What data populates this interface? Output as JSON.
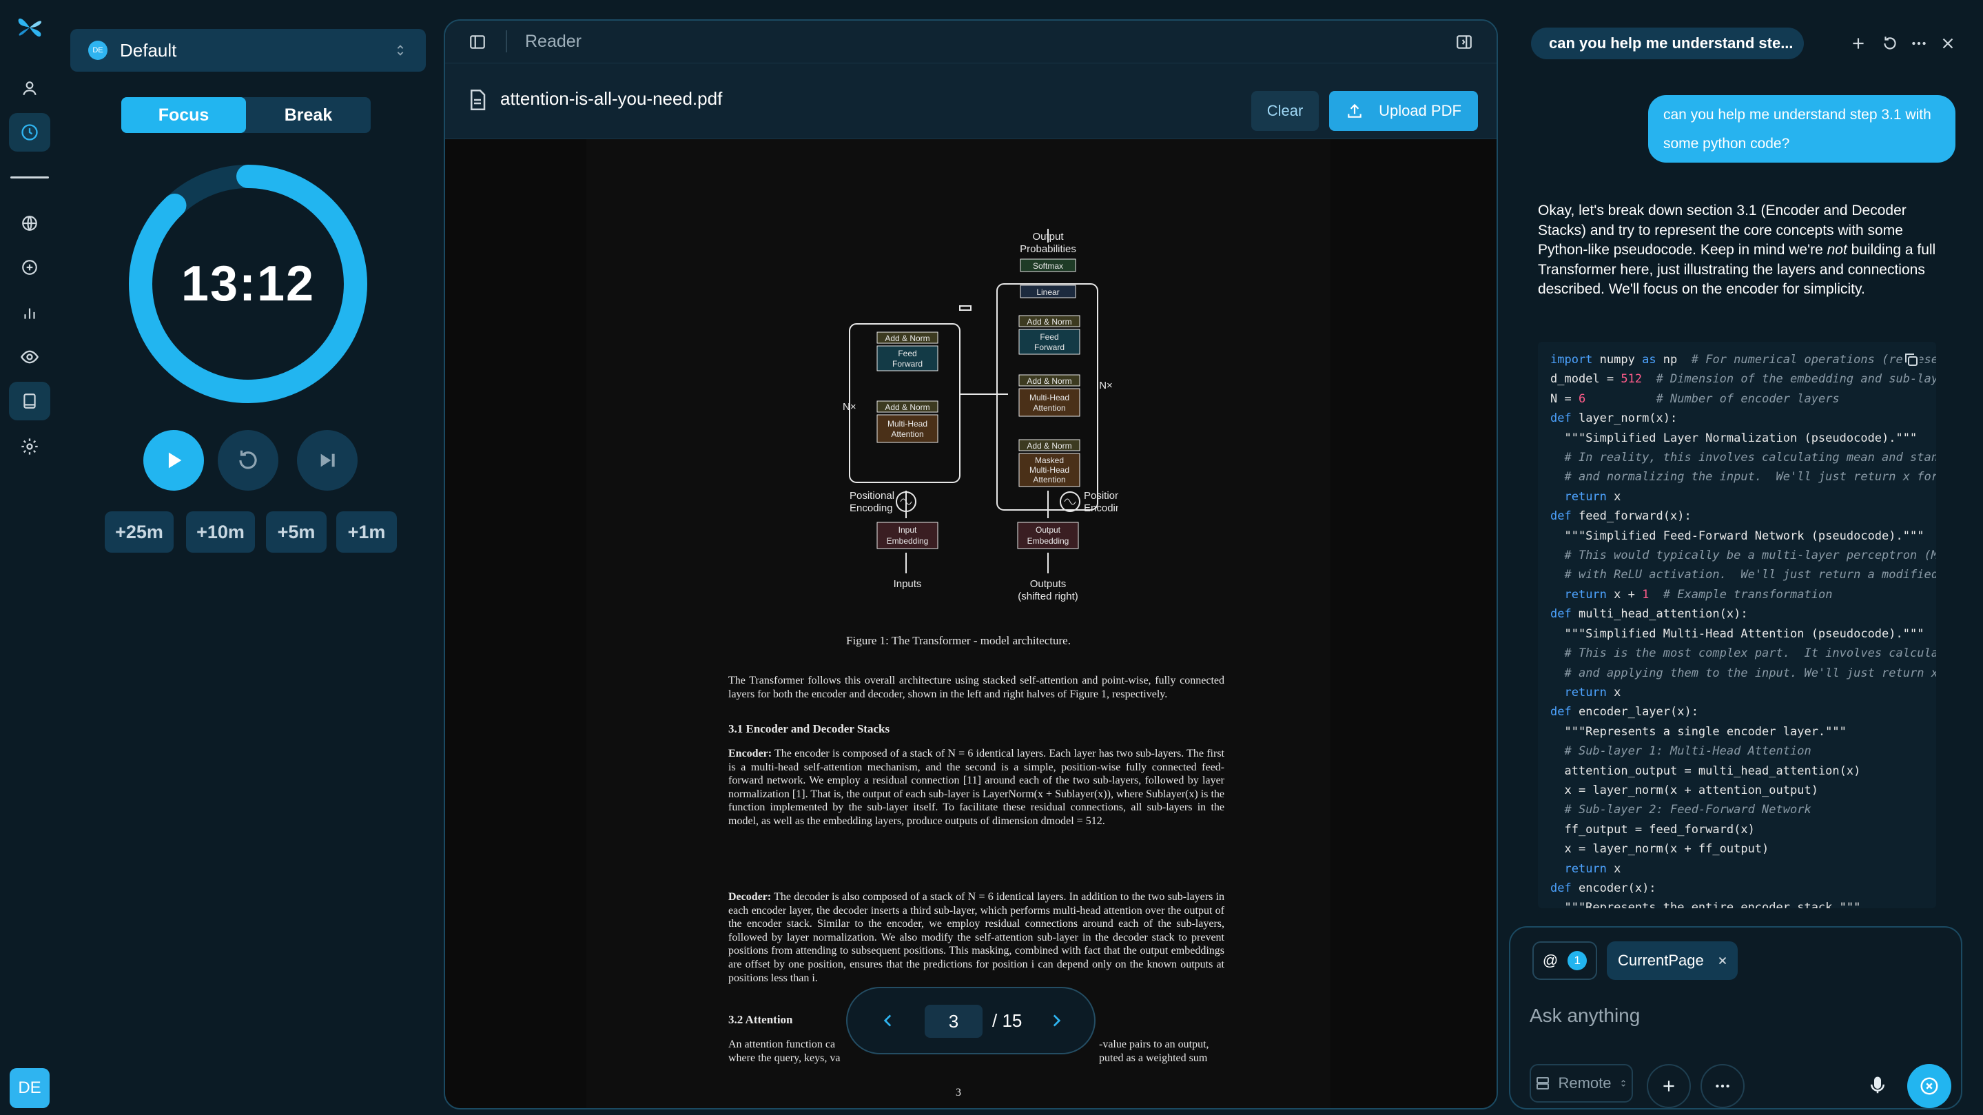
{
  "profile": {
    "badge": "DE",
    "name": "Default"
  },
  "timer": {
    "modes": [
      "Focus",
      "Break"
    ],
    "active_mode": "Focus",
    "time": "13:12",
    "progress": 0.88,
    "add_buttons": [
      "+25m",
      "+10m",
      "+5m",
      "+1m"
    ]
  },
  "user": {
    "avatar": "DE"
  },
  "reader": {
    "title": "Reader",
    "file_name": "attention-is-all-you-need.pdf",
    "clear_label": "Clear",
    "upload_label": "Upload PDF",
    "page": {
      "current": "3",
      "total": "/ 15",
      "footer_number": "3"
    },
    "figure": {
      "caption": "Figure 1: The Transformer - model architecture.",
      "labels": {
        "output_probs_1": "Output",
        "output_probs_2": "Probabilities",
        "softmax": "Softmax",
        "linear": "Linear",
        "add_norm": "Add & Norm",
        "feed": "Feed",
        "forward": "Forward",
        "multi_head": "Multi-Head",
        "attention": "Attention",
        "masked": "Masked",
        "nx": "N×",
        "positional": "Positional",
        "encoding": "Encoding",
        "input": "Input",
        "embedding": "Embedding",
        "output": "Output",
        "inputs": "Inputs",
        "outputs": "Outputs",
        "shifted": "(shifted right)"
      }
    },
    "body": {
      "intro": "The Transformer follows this overall architecture using stacked self-attention and point-wise, fully connected layers for both the encoder and decoder, shown in the left and right halves of Figure 1, respectively.",
      "s31_head": "3.1    Encoder and Decoder Stacks",
      "encoder_label": "Encoder:",
      "encoder_text": "The encoder is composed of a stack of N = 6 identical layers. Each layer has two sub-layers. The first is a multi-head self-attention mechanism, and the second is a simple, position-wise fully connected feed-forward network. We employ a residual connection [11] around each of the two sub-layers, followed by layer normalization [1]. That is, the output of each sub-layer is LayerNorm(x + Sublayer(x)), where Sublayer(x) is the function implemented by the sub-layer itself. To facilitate these residual connections, all sub-layers in the model, as well as the embedding layers, produce outputs of dimension dmodel = 512.",
      "decoder_label": "Decoder:",
      "decoder_text": "The decoder is also composed of a stack of N = 6 identical layers. In addition to the two sub-layers in each encoder layer, the decoder inserts a third sub-layer, which performs multi-head attention over the output of the encoder stack. Similar to the encoder, we employ residual connections around each of the sub-layers, followed by layer normalization. We also modify the self-attention sub-layer in the decoder stack to prevent positions from attending to subsequent positions. This masking, combined with fact that the output embeddings are offset by one position, ensures that the predictions for position i can depend only on the known outputs at positions less than i.",
      "s32_head": "3.2    Attention",
      "attn_left": "An attention function ca",
      "attn_left2": "where the query, keys, va",
      "attn_right": "-value pairs to an output,",
      "attn_right2": "puted as a weighted sum"
    }
  },
  "chat": {
    "tab_title": "can you help me understand ste...",
    "user_message": "can you help me understand step 3.1 with some python code?",
    "answer_pre": "Okay, let's break down section 3.1 (Encoder and Decoder Stacks) and try to represent the core concepts with some Python-like pseudocode. Keep in mind we're ",
    "answer_em": "not",
    "answer_post": " building a full Transformer here, just illustrating the layers and connections described.  We'll focus on the encoder for simplicity.",
    "code_lines": [
      "import numpy as np  # For numerical operations (represe",
      "d_model = 512  # Dimension of the embedding and sub-laye",
      "N = 6          # Number of encoder layers",
      "def layer_norm(x):",
      "  \"\"\"Simplified Layer Normalization (pseudocode).\"\"\"",
      "  # In reality, this involves calculating mean and stanc",
      "  # and normalizing the input.  We'll just return x for",
      "  return x",
      "def feed_forward(x):",
      "  \"\"\"Simplified Feed-Forward Network (pseudocode).\"\"\"",
      "  # This would typically be a multi-layer perceptron (ML",
      "  # with ReLU activation.  We'll just return a modified",
      "  return x + 1  # Example transformation",
      "def multi_head_attention(x):",
      "  \"\"\"Simplified Multi-Head Attention (pseudocode).\"\"\"",
      "  # This is the most complex part.  It involves calcula",
      "  # and applying them to the input. We'll just return x",
      "  return x",
      "def encoder_layer(x):",
      "  \"\"\"Represents a single encoder layer.\"\"\"",
      "  # Sub-layer 1: Multi-Head Attention",
      "  attention_output = multi_head_attention(x)",
      "  x = layer_norm(x + attention_output)",
      "  # Sub-layer 2: Feed-Forward Network",
      "  ff_output = feed_forward(x)",
      "  x = layer_norm(x + ff_output)",
      "  return x",
      "def encoder(x):",
      "  \"\"\"Represents the entire encoder stack.\"\"\""
    ],
    "composer": {
      "at": "@",
      "context_count": "1",
      "context_chip": "CurrentPage",
      "placeholder": "Ask anything",
      "remote_label": "Remote"
    }
  },
  "colors": {
    "accent": "#22b5f0",
    "background": "#0b1b25",
    "panel": "#123a52",
    "ring_track": "#0e3a52"
  },
  "icons": [
    "logo-icon",
    "user-icon",
    "clock-icon",
    "globe-icon",
    "plus-circle-icon",
    "bar-chart-icon",
    "eye-icon",
    "book-icon",
    "gear-icon",
    "sidebar-toggle-icon",
    "panel-right-icon",
    "document-icon",
    "upload-icon",
    "play-icon",
    "reset-icon",
    "skip-icon",
    "chevron-left-icon",
    "chevron-right-icon",
    "plus-icon",
    "history-icon",
    "more-icon",
    "close-icon",
    "microphone-icon",
    "send-icon",
    "copy-icon",
    "server-icon"
  ]
}
